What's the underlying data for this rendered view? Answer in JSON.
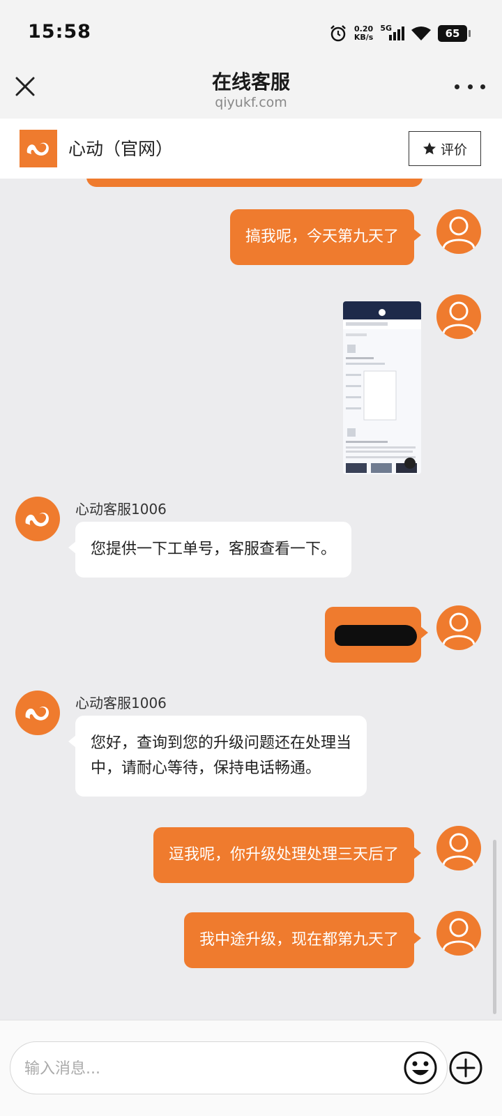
{
  "status_bar": {
    "time": "15:58",
    "net_speed_value": "0.20",
    "net_speed_unit": "KB/s",
    "network": "5G",
    "battery": "65",
    "icons": [
      "alarm-icon",
      "signal-icon",
      "wifi-icon",
      "battery-icon"
    ]
  },
  "header": {
    "title": "在线客服",
    "subtitle": "qiyukf.com",
    "close_icon": "close-icon",
    "more_icon": "more-icon"
  },
  "brand": {
    "name": "心动（官网）",
    "rate_label": "评价",
    "accent": "#ef7b2e"
  },
  "messages": [
    {
      "from": "user",
      "text": "搞我呢，今天第九天了"
    },
    {
      "from": "user",
      "type": "image"
    },
    {
      "from": "agent",
      "sender": "心动客服1006",
      "text": "您提供一下工单号，客服查看一下。"
    },
    {
      "from": "user",
      "type": "redacted"
    },
    {
      "from": "agent",
      "sender": "心动客服1006",
      "text_lines": [
        "您好，查询到您的升级问题还在处理当",
        "中，请耐心等待，保持电话畅通。"
      ]
    },
    {
      "from": "user",
      "text": "逗我呢，你升级处理处理三天后了"
    },
    {
      "from": "user",
      "text": "我中途升级，现在都第九天了"
    }
  ],
  "input": {
    "placeholder": "输入消息...",
    "emoji_icon": "emoji-icon",
    "plus_icon": "plus-icon"
  }
}
